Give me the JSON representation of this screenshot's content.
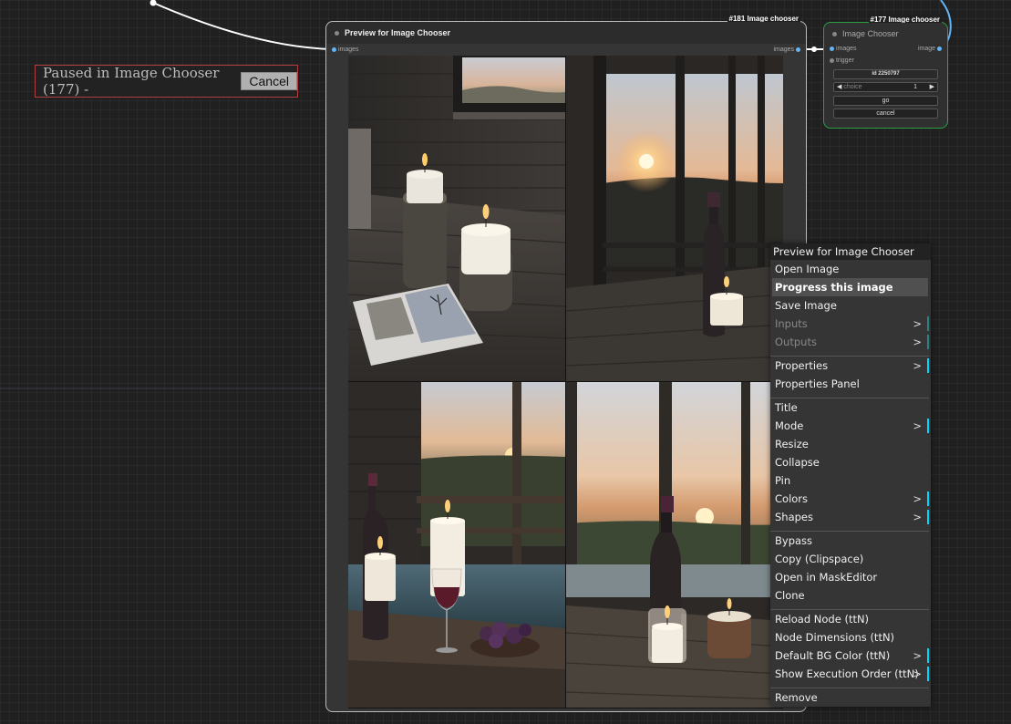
{
  "paused_banner": {
    "text": "Paused in Image Chooser (177) -",
    "cancel_label": "Cancel"
  },
  "preview_node": {
    "badge": "#181 Image chooser",
    "title": "Preview for Image Chooser",
    "input_label": "images",
    "output_label": "images"
  },
  "chooser_node": {
    "badge": "#177 Image chooser",
    "title": "Image Chooser",
    "input_images": "images",
    "input_trigger": "trigger",
    "output_image": "image",
    "id_label": "id 2250797",
    "choice_label": "choice",
    "choice_value": "1",
    "go_label": "go",
    "cancel_label": "cancel"
  },
  "context_menu": {
    "title": "Preview for Image Chooser",
    "items": [
      {
        "label": "Open Image"
      },
      {
        "label": "Progress this image"
      },
      {
        "label": "Save Image"
      },
      {
        "label": "Inputs"
      },
      {
        "label": "Outputs"
      },
      {
        "label": "Properties"
      },
      {
        "label": "Properties Panel"
      },
      {
        "label": "Title"
      },
      {
        "label": "Mode"
      },
      {
        "label": "Resize"
      },
      {
        "label": "Collapse"
      },
      {
        "label": "Pin"
      },
      {
        "label": "Colors"
      },
      {
        "label": "Shapes"
      },
      {
        "label": "Bypass"
      },
      {
        "label": "Copy (Clipspace)"
      },
      {
        "label": "Open in MaskEditor"
      },
      {
        "label": "Clone"
      },
      {
        "label": "Reload Node (ttN)"
      },
      {
        "label": "Node Dimensions (ttN)"
      },
      {
        "label": "Default BG Color (ttN)"
      },
      {
        "label": "Show Execution Order (ttN)"
      },
      {
        "label": "Remove"
      }
    ],
    "submenu_arrow": ">"
  },
  "colors": {
    "selected_node_border": "#2e9e44",
    "link_wire": "#ffffff",
    "image_link": "#64b5f6",
    "submenu_bar": "#00d5ff",
    "paused_border": "#b04040"
  }
}
